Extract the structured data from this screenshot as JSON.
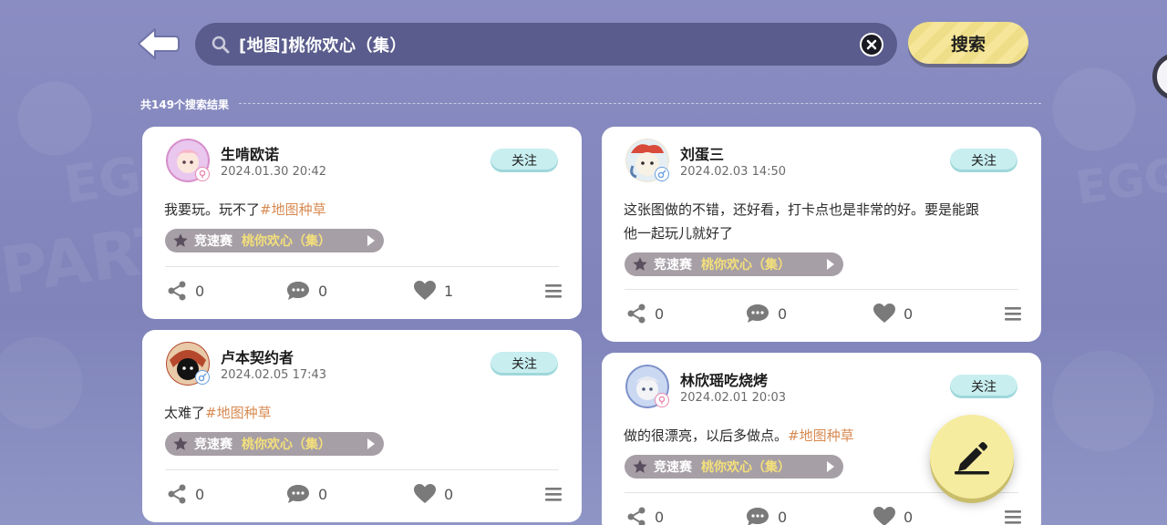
{
  "search": {
    "query": "[地图]桃你欢心（集）",
    "button_label": "搜索"
  },
  "results": {
    "count_label": "共149个搜索结果"
  },
  "posts": [
    {
      "username": "生啃欧诺",
      "time": "2024.01.30 20:42",
      "follow_label": "关注",
      "text": "我要玩。玩不了",
      "tag": "#地图种草",
      "text2": "",
      "map_mode": "竞速赛",
      "map_name": "桃你欢心（集）",
      "shares": "0",
      "comments": "0",
      "likes": "1",
      "avatar_color": "#f1b9d8",
      "gender": "female"
    },
    {
      "username": "卢本契约者",
      "time": "2024.02.05 17:43",
      "follow_label": "关注",
      "text": "太难了",
      "tag": "#地图种草",
      "text2": "",
      "map_mode": "竞速赛",
      "map_name": "桃你欢心（集）",
      "shares": "0",
      "comments": "0",
      "likes": "0",
      "avatar_color": "#b5482c",
      "gender": "male"
    },
    {
      "username": "刘蛋三",
      "time": "2024.02.03 14:50",
      "follow_label": "关注",
      "text": "这张图做的不错，还好看，打卡点也是非常的好。要是能跟",
      "text2": "他一起玩儿就好了",
      "tag": "",
      "map_mode": "竞速赛",
      "map_name": "桃你欢心（集）",
      "shares": "0",
      "comments": "0",
      "likes": "0",
      "avatar_color": "#f0e4cf",
      "gender": "male"
    },
    {
      "username": "林欣瑶吃烧烤",
      "time": "2024.02.01 20:03",
      "follow_label": "关注",
      "text": "做的很漂亮，以后多做点。",
      "tag": "#地图种草",
      "text2": "",
      "map_mode": "竞速赛",
      "map_name": "桃你欢心（集）",
      "shares": "0",
      "comments": "0",
      "likes": "0",
      "avatar_color": "#c9d6f2",
      "gender": "female"
    }
  ],
  "colors": {
    "background": "#8487bd",
    "search_bar": "#595c8c",
    "search_button": "#f5e69a",
    "follow_button": "#c8eef0",
    "map_pill": "#a79fa6",
    "map_name": "#f4e07a",
    "tag_link": "#d88a52"
  },
  "icons": [
    "back-arrow-icon",
    "search-icon",
    "clear-icon",
    "star-icon",
    "play-icon",
    "share-icon",
    "comment-icon",
    "heart-icon",
    "menu-icon",
    "edit-pencil-icon"
  ]
}
